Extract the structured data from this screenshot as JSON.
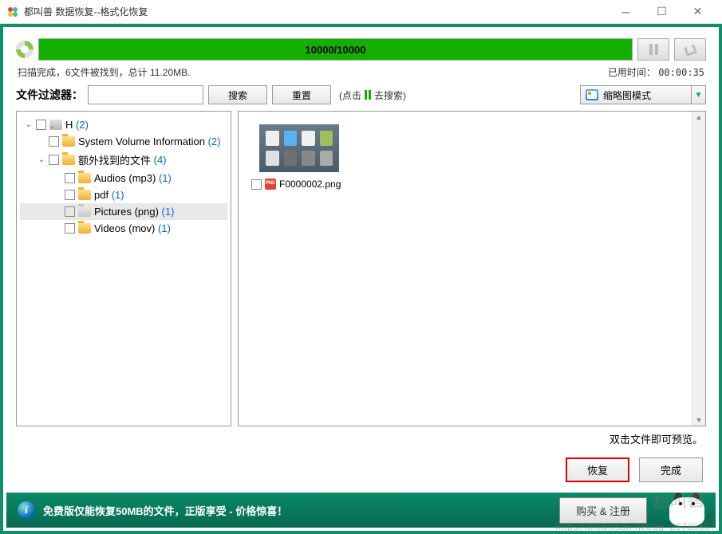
{
  "window": {
    "title": "都叫兽 数据恢复--格式化恢复"
  },
  "progress": {
    "text": "10000/10000"
  },
  "status": {
    "text": "扫描完成，6文件被找到，总计 11.20MB.",
    "time_label": "已用时间：",
    "time_value": "00:00:35"
  },
  "filter": {
    "label": "文件过滤器：",
    "input_value": "",
    "search_btn": "搜索",
    "reset_btn": "重置",
    "hint_prefix": "(点击",
    "hint_suffix": "去搜索)"
  },
  "view_mode": {
    "label": "缩略图模式"
  },
  "tree": {
    "root": {
      "label": "H",
      "count": "(2)"
    },
    "svi": {
      "label": "System Volume Information",
      "count": "(2)"
    },
    "extra": {
      "label": "额外找到的文件",
      "count": "(4)"
    },
    "audios": {
      "label": "Audios (mp3)",
      "count": "(1)"
    },
    "pdf": {
      "label": "pdf",
      "count": "(1)"
    },
    "pictures": {
      "label": "Pictures (png)",
      "count": "(1)"
    },
    "videos": {
      "label": "Videos (mov)",
      "count": "(1)"
    }
  },
  "file": {
    "name": "F0000002.png"
  },
  "preview_hint": "双击文件即可预览。",
  "actions": {
    "recover": "恢复",
    "finish": "完成"
  },
  "bottom": {
    "msg": "免费版仅能恢复50MB的文件，正版享受 - 价格惊喜！",
    "buy": "购买 & 注册"
  },
  "watermark": {
    "cn": "都叫兽",
    "url": "https://blog.csdn.net/qq_29785857"
  }
}
